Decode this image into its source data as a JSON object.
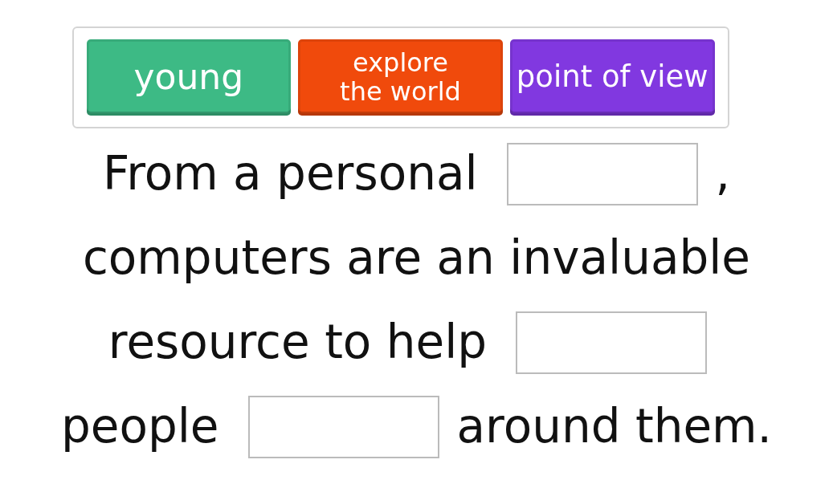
{
  "word_bank": [
    {
      "text": "young",
      "color": "#3dba85"
    },
    {
      "text": "explore the world",
      "color": "#f04a0c"
    },
    {
      "text": "point of view",
      "color": "#8138e0"
    }
  ],
  "lines": [
    [
      {
        "kind": "text",
        "text": "From a personal"
      },
      {
        "kind": "blank"
      },
      {
        "kind": "text",
        "text": ","
      }
    ],
    [
      {
        "kind": "text",
        "text": "computers are an invaluable"
      }
    ],
    [
      {
        "kind": "text",
        "text": "resource to help"
      },
      {
        "kind": "blank"
      }
    ],
    [
      {
        "kind": "text",
        "text": "people"
      },
      {
        "kind": "blank"
      },
      {
        "kind": "text",
        "text": "around them."
      }
    ]
  ]
}
